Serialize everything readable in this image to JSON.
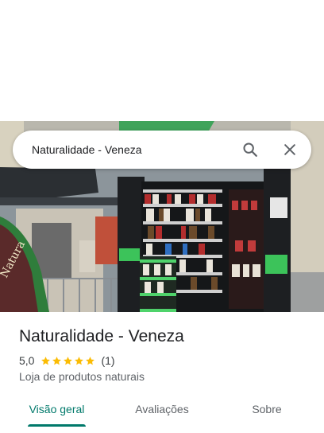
{
  "search": {
    "query": "Naturalidade - Veneza"
  },
  "place": {
    "name": "Naturalidade - Veneza",
    "rating": "5,0",
    "rating_value": 5.0,
    "stars": 5,
    "review_count": "(1)",
    "category": "Loja de produtos naturais"
  },
  "photo": {
    "banner_text": "Natura"
  },
  "tabs": [
    {
      "label": "Visão geral",
      "active": true
    },
    {
      "label": "Avaliações",
      "active": false
    },
    {
      "label": "Sobre",
      "active": false
    }
  ],
  "colors": {
    "accent": "#00796b",
    "star": "#fbbc04",
    "text_primary": "#202124",
    "text_secondary": "#5f6368"
  },
  "icons": {
    "search": "search-icon",
    "close": "close-icon",
    "star": "star-icon"
  }
}
